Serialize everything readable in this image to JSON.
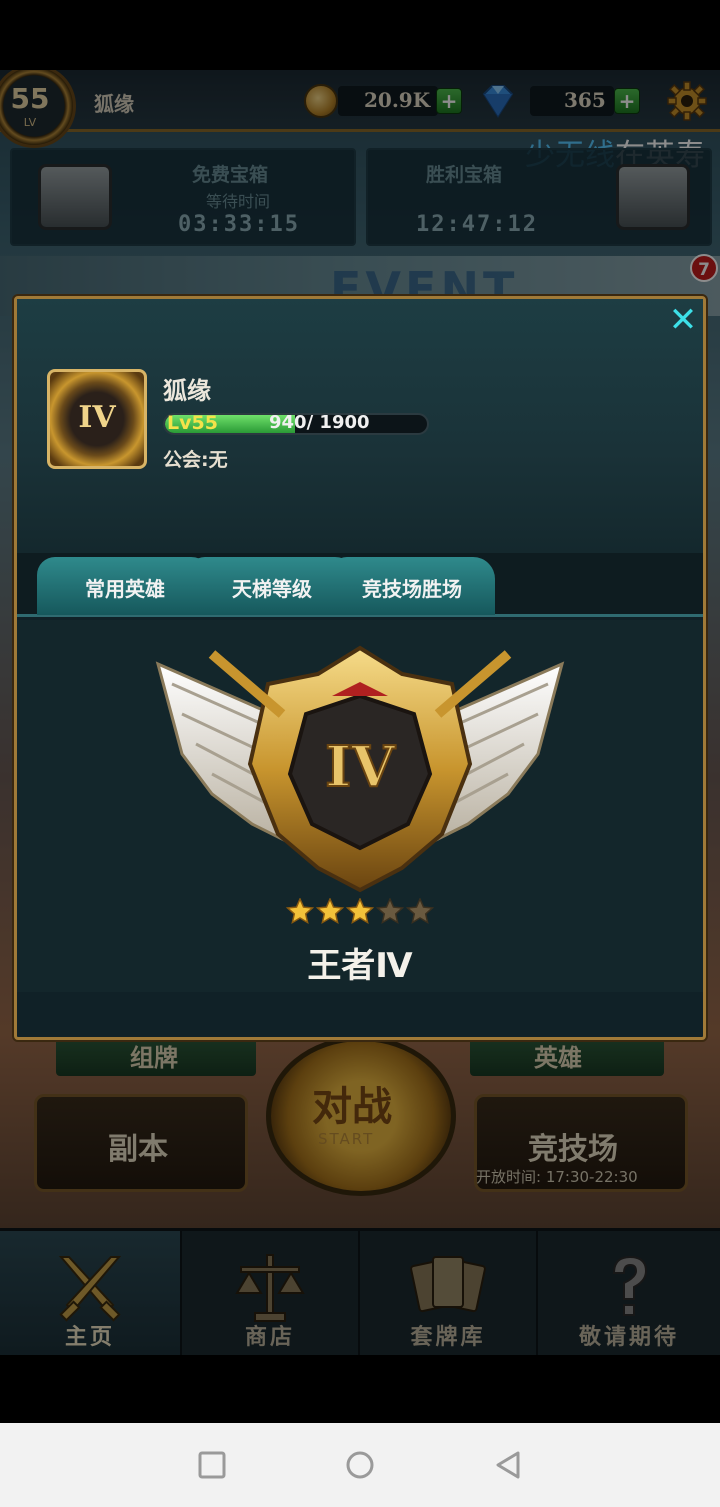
{
  "hud": {
    "level": "55",
    "level_label": "LV",
    "player_name": "狐缘",
    "gold": "20.9K",
    "gems": "365",
    "plus": "+"
  },
  "marquee": {
    "blue_part": "少无线",
    "white_part": "在英",
    "trail": "寿"
  },
  "chests": {
    "free": {
      "title": "免费宝箱",
      "subtitle": "等待时间",
      "timer": "03:33:15"
    },
    "victory": {
      "title": "胜利宝箱",
      "timer": "12:47:12"
    }
  },
  "event": {
    "text": "EVENT",
    "badge": "7"
  },
  "modal": {
    "close": "✕",
    "player_name": "狐缘",
    "avatar_rank": "IV",
    "level_label": "Lv55",
    "xp_current": 940,
    "xp_max": 1900,
    "xp_text": "940/ 1900",
    "guild": "公会:无",
    "tabs": [
      {
        "label": "常用英雄"
      },
      {
        "label": "天梯等级"
      },
      {
        "label": "竞技场胜场"
      }
    ],
    "rank_numeral": "IV",
    "stars_filled": 3,
    "stars_total": 5,
    "rank_name": "王者Ⅳ"
  },
  "lower": {
    "deck": "组牌",
    "heroes": "英雄",
    "dungeon": "副本",
    "battle": "对战",
    "start": "START",
    "arena": "竞技场",
    "arena_time": "开放时间: 17:30-22:30"
  },
  "nav": [
    {
      "label": "主页",
      "icon": "swords-icon"
    },
    {
      "label": "商店",
      "icon": "scales-icon"
    },
    {
      "label": "套牌库",
      "icon": "cards-icon"
    },
    {
      "label": "敬请期待",
      "icon": "question-icon"
    }
  ],
  "colors": {
    "accent_cyan": "#3de0e8",
    "gold_border": "#a07a38",
    "xp_green": "#4cc44e",
    "level_yellow": "#f4e24a"
  }
}
